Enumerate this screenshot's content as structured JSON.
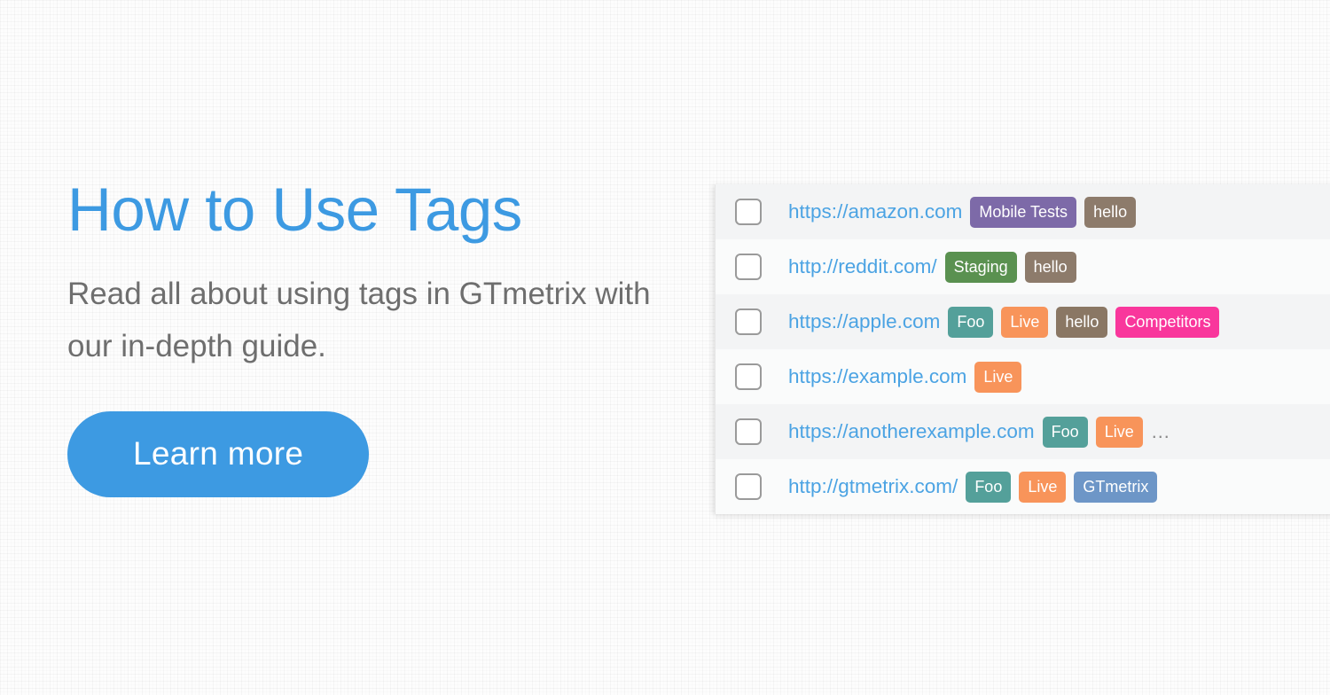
{
  "promo": {
    "title": "How to Use Tags",
    "subtitle": "Read all about using tags in GTmetrix with our in-depth guide.",
    "button_label": "Learn more",
    "accent_color": "#3d9ae2",
    "subtitle_color": "#6e6e6e"
  },
  "table": {
    "link_color": "#4ba3e3",
    "row_bg_odd": "#f3f4f5",
    "row_bg_even": "#fafbfb",
    "rows": [
      {
        "url": "https://amazon.com",
        "tags": [
          {
            "label": "Mobile Tests",
            "color": "#7d6aa8"
          },
          {
            "label": "hello",
            "color": "#8d7b6b"
          }
        ],
        "overflow": "",
        "browser_icon": "chrome-icon",
        "flag_icon": "flag-uk-icon"
      },
      {
        "url": "http://reddit.com/",
        "tags": [
          {
            "label": "Staging",
            "color": "#5a9150"
          },
          {
            "label": "hello",
            "color": "#8d7b6b"
          }
        ],
        "overflow": "",
        "browser_icon": "chrome-icon",
        "flag_icon": "flag-uk-icon"
      },
      {
        "url": "https://apple.com",
        "tags": [
          {
            "label": "Foo",
            "color": "#54a09a"
          },
          {
            "label": "Live",
            "color": "#f8945a"
          },
          {
            "label": "hello",
            "color": "#8a7764"
          },
          {
            "label": "Competitors",
            "color": "#f9379c"
          }
        ],
        "overflow": "",
        "browser_icon": "chrome-icon",
        "flag_icon": "flag-uk-icon"
      },
      {
        "url": "https://example.com",
        "tags": [
          {
            "label": "Live",
            "color": "#f8945a"
          }
        ],
        "overflow": "",
        "browser_icon": "chrome-icon",
        "flag_icon": "flag-canada-icon"
      },
      {
        "url": "https://anotherexample.com",
        "tags": [
          {
            "label": "Foo",
            "color": "#54a09a"
          },
          {
            "label": "Live",
            "color": "#f8945a"
          }
        ],
        "overflow": "…",
        "browser_icon": "chrome-icon",
        "flag_icon": "flag-uk-icon"
      },
      {
        "url": "http://gtmetrix.com/",
        "tags": [
          {
            "label": "Foo",
            "color": "#54a09a"
          },
          {
            "label": "Live",
            "color": "#f8945a"
          },
          {
            "label": "GTmetrix",
            "color": "#6d96c7"
          }
        ],
        "overflow": "",
        "browser_icon": "chrome-icon",
        "flag_icon": "flag-uk-icon"
      }
    ]
  }
}
